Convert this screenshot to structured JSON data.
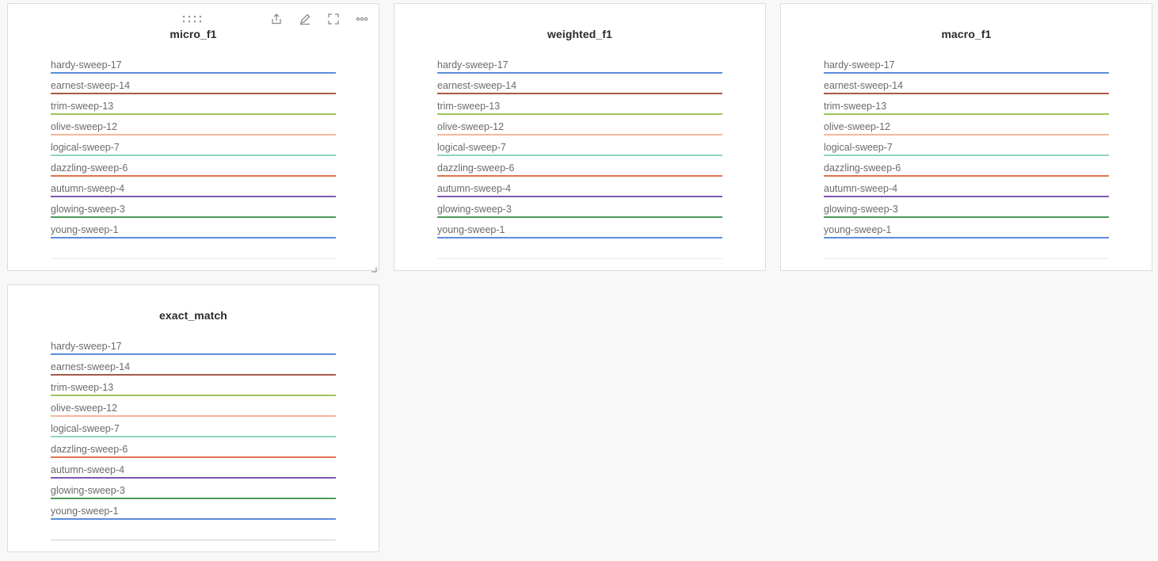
{
  "panels": [
    {
      "id": "micro",
      "title": "micro_f1"
    },
    {
      "id": "weighted",
      "title": "weighted_f1"
    },
    {
      "id": "macro",
      "title": "macro_f1"
    },
    {
      "id": "exact",
      "title": "exact_match"
    }
  ],
  "runs": [
    {
      "label": "hardy-sweep-17",
      "color": "#5b8ddb"
    },
    {
      "label": "earnest-sweep-14",
      "color": "#a85a47"
    },
    {
      "label": "trim-sweep-13",
      "color": "#9cc75a"
    },
    {
      "label": "olive-sweep-12",
      "color": "#f5b89a"
    },
    {
      "label": "logical-sweep-7",
      "color": "#8fd4c4"
    },
    {
      "label": "dazzling-sweep-6",
      "color": "#e0744b"
    },
    {
      "label": "autumn-sweep-4",
      "color": "#7f56b3"
    },
    {
      "label": "glowing-sweep-3",
      "color": "#4f9a5e"
    },
    {
      "label": "young-sweep-1",
      "color": "#5b8ddb"
    }
  ],
  "toolbar": {
    "icons": [
      "share-icon",
      "edit-icon",
      "fullscreen-icon",
      "more-icon"
    ]
  }
}
